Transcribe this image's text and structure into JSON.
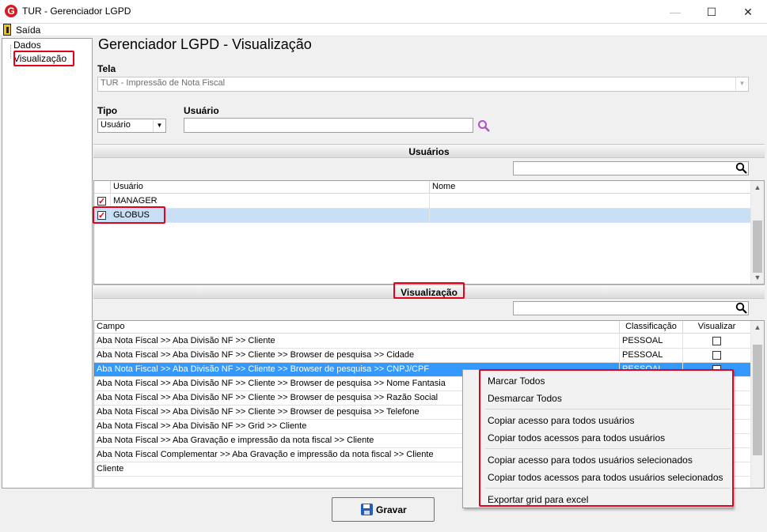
{
  "window": {
    "title": "TUR - Gerenciador LGPD",
    "logo": "G",
    "min": "—",
    "max": "☐",
    "close": "✕"
  },
  "menu": {
    "exit_label": "Saída"
  },
  "tree": {
    "items": [
      "Dados",
      "Visualização"
    ]
  },
  "header": {
    "title": "Gerenciador LGPD - Visualização"
  },
  "tela": {
    "label": "Tela",
    "value": "TUR - Impressão de Nota Fiscal"
  },
  "tipo": {
    "label": "Tipo",
    "value": "Usuário"
  },
  "usuario": {
    "label": "Usuário",
    "value": ""
  },
  "users_section": {
    "title": "Usuários",
    "columns": [
      "Usuário",
      "Nome"
    ],
    "rows": [
      {
        "usuario": "MANAGER",
        "nome": "",
        "checked": true
      },
      {
        "usuario": "GLOBUS",
        "nome": "",
        "checked": true
      }
    ]
  },
  "view_section": {
    "title": "Visualização",
    "columns": [
      "Campo",
      "Classificação",
      "Visualizar"
    ],
    "rows": [
      {
        "campo": "Aba Nota Fiscal >> Aba Divisão NF >> Cliente",
        "class": "PESSOAL"
      },
      {
        "campo": "Aba Nota Fiscal >> Aba Divisão NF >> Cliente >> Browser de pesquisa >> Cidade",
        "class": "PESSOAL"
      },
      {
        "campo": "Aba Nota Fiscal >> Aba Divisão NF >> Cliente >> Browser de pesquisa >> CNPJ/CPF",
        "class": "PESSOAL"
      },
      {
        "campo": "Aba Nota Fiscal >> Aba Divisão NF >> Cliente >> Browser de pesquisa >> Nome Fantasia",
        "class": ""
      },
      {
        "campo": "Aba Nota Fiscal >> Aba Divisão NF >> Cliente >> Browser de pesquisa >> Razão Social",
        "class": ""
      },
      {
        "campo": "Aba Nota Fiscal >> Aba Divisão NF >> Cliente >> Browser de pesquisa >> Telefone",
        "class": ""
      },
      {
        "campo": "Aba Nota Fiscal >> Aba Divisão NF >> Grid >> Cliente",
        "class": ""
      },
      {
        "campo": "Aba Nota Fiscal >> Aba Gravação e impressão da nota fiscal >> Cliente",
        "class": ""
      },
      {
        "campo": "Aba Nota Fiscal Complementar >> Aba Gravação e impressão da nota fiscal >> Cliente",
        "class": ""
      },
      {
        "campo": "Cliente",
        "class": ""
      }
    ]
  },
  "context_menu": {
    "items": [
      "Marcar Todos",
      "Desmarcar Todos",
      "Copiar acesso para todos usuários",
      "Copiar todos acessos para todos usuários",
      "Copiar acesso para todos usuários selecionados",
      "Copiar todos acessos para todos usuários selecionados",
      "Exportar grid para excel"
    ]
  },
  "save": {
    "label": "Gravar"
  },
  "colors": {
    "accent_red": "#e3001b",
    "selection": "#3399ff",
    "search_icon": "#b04fc9"
  }
}
